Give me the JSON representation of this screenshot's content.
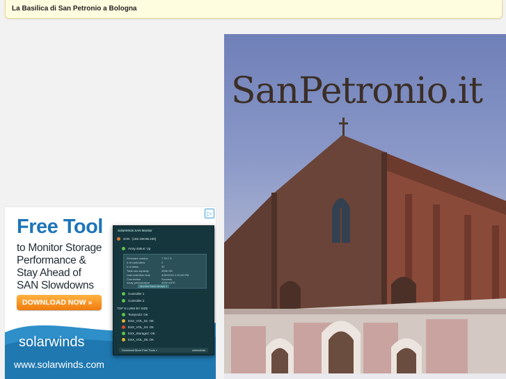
{
  "header": {
    "title": "La Basilica di San Petronio a Bologna"
  },
  "ad": {
    "choices_icon": "adchoices-icon",
    "headline": "Free Tool",
    "copy_lines": [
      "to Monitor Storage",
      "Performance &",
      "Stay Ahead of",
      "SAN Slowdowns"
    ],
    "cta": "DOWNLOAD NOW »",
    "logo": "solarwinds",
    "url": "www.solarwinds.com",
    "colors": {
      "headline": "#1e74b8",
      "cta": "#f07b0d",
      "wave": "#2e8fc9"
    },
    "mock": {
      "title": "SolarWinds SAN Monitor",
      "sub": "SAN - [192.168.86.230]",
      "array": "Array status: Up",
      "panel": [
        [
          "Firmware version",
          "7.78.7.9"
        ],
        [
          "# of controllers",
          "2"
        ],
        [
          "# of disks",
          "32"
        ],
        [
          "Total raw capacity",
          "2656 GB"
        ],
        [
          "Last collection time",
          "4/30/2010 1:32:00 PM"
        ],
        [
          "Connection",
          "Success"
        ],
        [
          "Array performance",
          "4930 IOPS"
        ]
      ],
      "panel_button": "Monitor More Arrays »",
      "controllers": [
        "Controller 1",
        "Controller 2"
      ],
      "luns_heading": "TOP 5 LUNS BY SIZE",
      "luns": [
        "TempVol2: OK",
        "ESX_VOL_01: OK",
        "ESX_VOL_04: OK",
        "ESX_Storage2: OK",
        "ESX_VOL_05: OK"
      ],
      "footer": "Download More Free Tools »",
      "footer_logo": "solarwinds"
    }
  },
  "hero": {
    "title": "SanPetronio.it"
  }
}
